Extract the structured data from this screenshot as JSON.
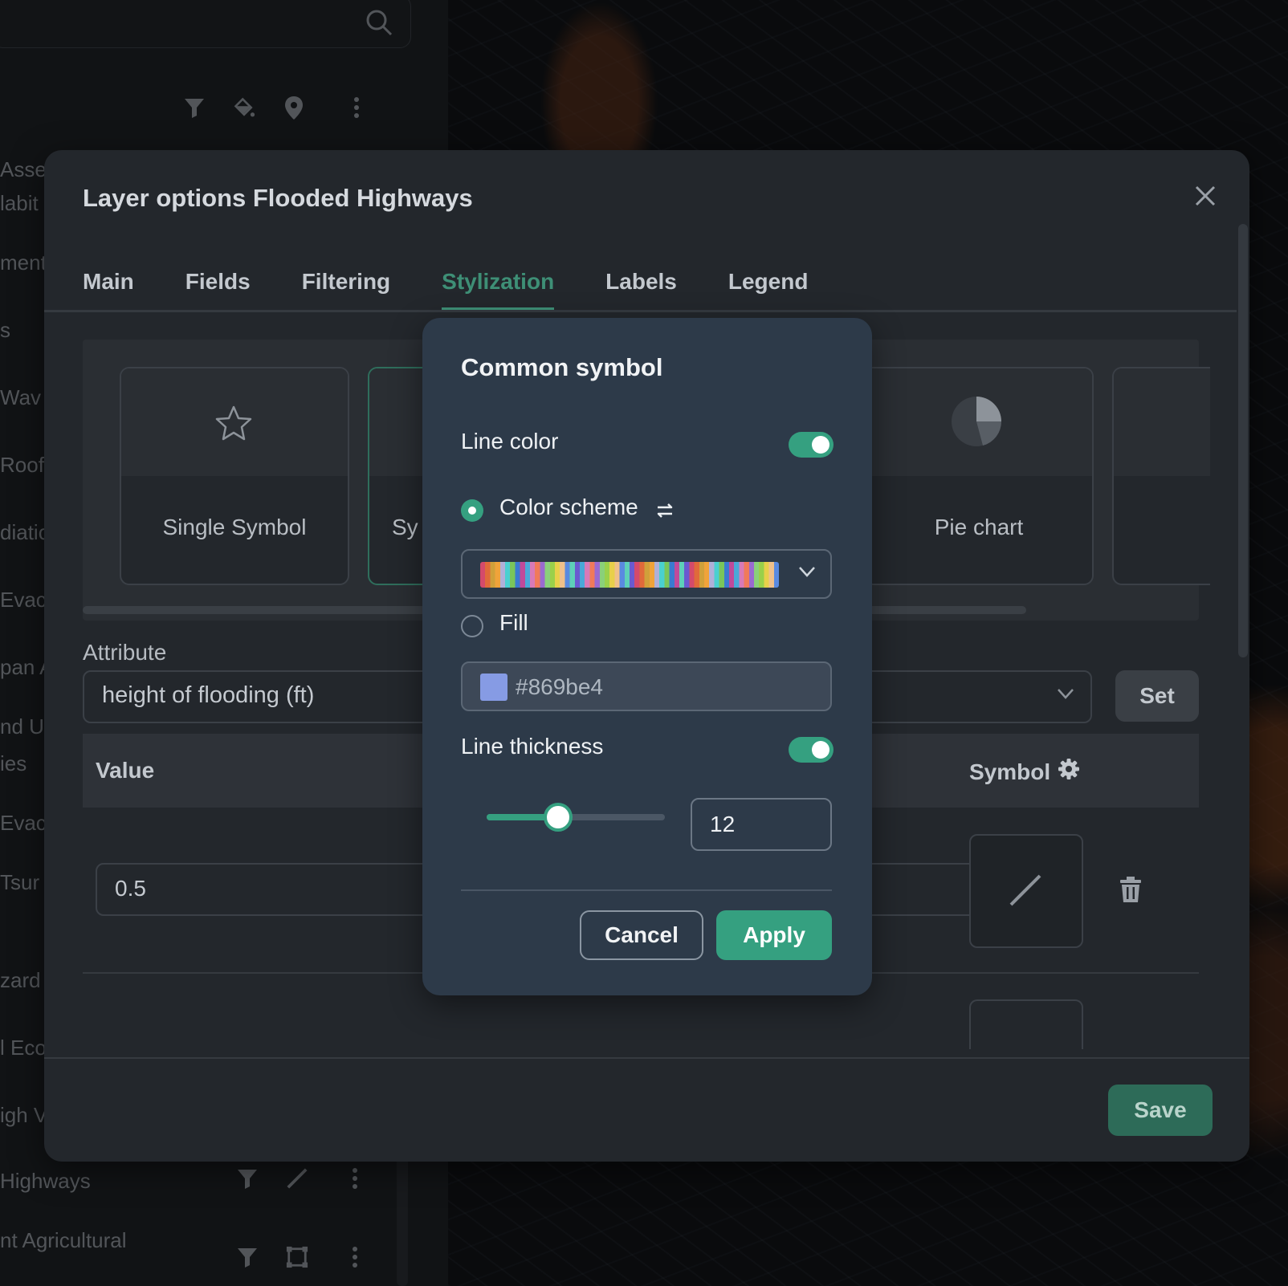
{
  "sidebar": {
    "search": {
      "icon": "search-icon"
    },
    "toolbar_icons": [
      "filter-icon",
      "paint-bucket-icon",
      "map-pin-icon",
      "more-vertical-icon"
    ],
    "layers_cropped": [
      "Asse",
      "labit",
      "ment",
      "s",
      "Wav",
      "Roof",
      "diatio",
      "Evac",
      "pan A",
      "nd U",
      "ies",
      "Evac",
      "Tsur",
      "zard",
      "l Eco",
      "igh V"
    ],
    "bottom_layers": [
      {
        "label": "Highways",
        "icons": [
          "filter-icon",
          "line-style-icon",
          "more-vertical-icon"
        ]
      },
      {
        "label": "nt Agricultural",
        "icons": [
          "filter-icon",
          "polygon-select-icon",
          "more-vertical-icon"
        ]
      }
    ]
  },
  "dialog": {
    "title": "Layer options Flooded Highways",
    "tabs": [
      {
        "label": "Main",
        "active": false
      },
      {
        "label": "Fields",
        "active": false
      },
      {
        "label": "Filtering",
        "active": false
      },
      {
        "label": "Stylization",
        "active": true
      },
      {
        "label": "Labels",
        "active": false
      },
      {
        "label": "Legend",
        "active": false
      }
    ],
    "style_types": [
      {
        "label": "Single Symbol",
        "icon": "star-icon"
      },
      {
        "label": "Sy",
        "icon": ""
      },
      {
        "label": "Pie chart",
        "icon": "pie-chart-icon"
      }
    ],
    "attribute": {
      "label": "Attribute",
      "value": "height of flooding (ft)",
      "set_label": "Set"
    },
    "table": {
      "value_header": "Value",
      "symbol_header": "Symbol",
      "rows": [
        {
          "value": "0.5"
        }
      ]
    },
    "save_label": "Save"
  },
  "popover": {
    "title": "Common symbol",
    "line_color": {
      "label": "Line color",
      "enabled": true
    },
    "color_scheme": {
      "label": "Color scheme",
      "selected": true
    },
    "fill": {
      "label": "Fill",
      "selected": false,
      "value": "#869be4"
    },
    "line_thickness": {
      "label": "Line thickness",
      "enabled": true,
      "value": "12",
      "slider_fraction": 0.4
    },
    "cancel_label": "Cancel",
    "apply_label": "Apply"
  },
  "colors": {
    "accent": "#35a080",
    "active_tab": "#3e8f76",
    "fill_swatch": "#869be4",
    "scheme": [
      "#d44a6b",
      "#f0a33a",
      "#7ac55a",
      "#4aa8d8",
      "#9a6ad0",
      "#e8d04a",
      "#5ed0b8",
      "#e06a3a",
      "#b0b0d8",
      "#3a7ad0",
      "#d87ab8",
      "#8ad07a",
      "#f0c08a",
      "#6a5ad0",
      "#d0a03a",
      "#4ad0d0",
      "#c04a9a",
      "#f07a5a",
      "#9ad04a",
      "#5a8ae0"
    ]
  }
}
